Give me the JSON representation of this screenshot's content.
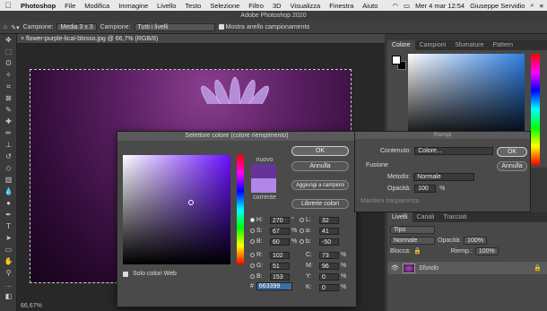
{
  "menubar": {
    "app": "Photoshop",
    "items": [
      "File",
      "Modifica",
      "Immagine",
      "Livello",
      "Testo",
      "Selezione",
      "Filtro",
      "3D",
      "Visualizza",
      "Finestra",
      "Aiuto"
    ],
    "datetime": "Mer 4 mar 12:54",
    "user": "Giuseppe Servidio"
  },
  "window": {
    "title": "Adobe Photoshop 2020"
  },
  "options": {
    "sample_label": "Campione:",
    "sample_value": "Media 3 x 3",
    "sample2_label": "Campione:",
    "sample2_value": "Tutti i livelli",
    "ring_label": "Mostra anello campionamento"
  },
  "document": {
    "tab": "flower-purple-lical-blosso.jpg @ 66,7% (RGB/8)",
    "zoom": "66,67%"
  },
  "color_panel": {
    "tabs": [
      "Colore",
      "Campioni",
      "Sfumature",
      "Pattern"
    ],
    "active": "Colore"
  },
  "layers_panel": {
    "tabs": [
      "Livelli",
      "Canali",
      "Tracciati"
    ],
    "active": "Livelli",
    "filter": "Tipo",
    "blend": "Normale",
    "opacity_label": "Opacità:",
    "opacity": "100%",
    "lock_label": "Blocca:",
    "fill_label": "Riemp.:",
    "fill": "100%",
    "layer_name": "Sfondo"
  },
  "picker": {
    "title": "Selettore colore (colore riempimento)",
    "new_label": "nuovo",
    "current_label": "corrente",
    "buttons": {
      "ok": "OK",
      "cancel": "Annulla",
      "add_swatch": "Aggiungi a campioni",
      "libraries": "Librerie colori"
    },
    "web_only": "Solo colori Web",
    "fields": {
      "H": {
        "label": "H:",
        "value": "270",
        "unit": "°"
      },
      "S": {
        "label": "S:",
        "value": "67",
        "unit": "%"
      },
      "B": {
        "label": "B:",
        "value": "60",
        "unit": "%"
      },
      "R": {
        "label": "R:",
        "value": "102",
        "unit": ""
      },
      "G": {
        "label": "G:",
        "value": "51",
        "unit": ""
      },
      "Bl": {
        "label": "B:",
        "value": "153",
        "unit": ""
      },
      "L": {
        "label": "L:",
        "value": "32",
        "unit": ""
      },
      "a": {
        "label": "a:",
        "value": "41",
        "unit": ""
      },
      "b": {
        "label": "b:",
        "value": "-50",
        "unit": ""
      },
      "C": {
        "label": "C:",
        "value": "73",
        "unit": "%"
      },
      "M": {
        "label": "M:",
        "value": "96",
        "unit": "%"
      },
      "Y": {
        "label": "Y:",
        "value": "0",
        "unit": "%"
      },
      "K": {
        "label": "K:",
        "value": "0",
        "unit": "%"
      }
    },
    "hex": "663399"
  },
  "fill": {
    "title": "Riempi",
    "content_label": "Contenuto:",
    "content_value": "Colore...",
    "blend_section": "Fusione",
    "method_label": "Metodo:",
    "method_value": "Normale",
    "opacity_label": "Opacità:",
    "opacity_value": "100",
    "opacity_unit": "%",
    "preserve": "Mantieni trasparenza",
    "ok": "OK",
    "cancel": "Annulla"
  },
  "colors": {
    "new": "#663399",
    "current": "#b086e8",
    "accent": "#3a6ea5"
  }
}
